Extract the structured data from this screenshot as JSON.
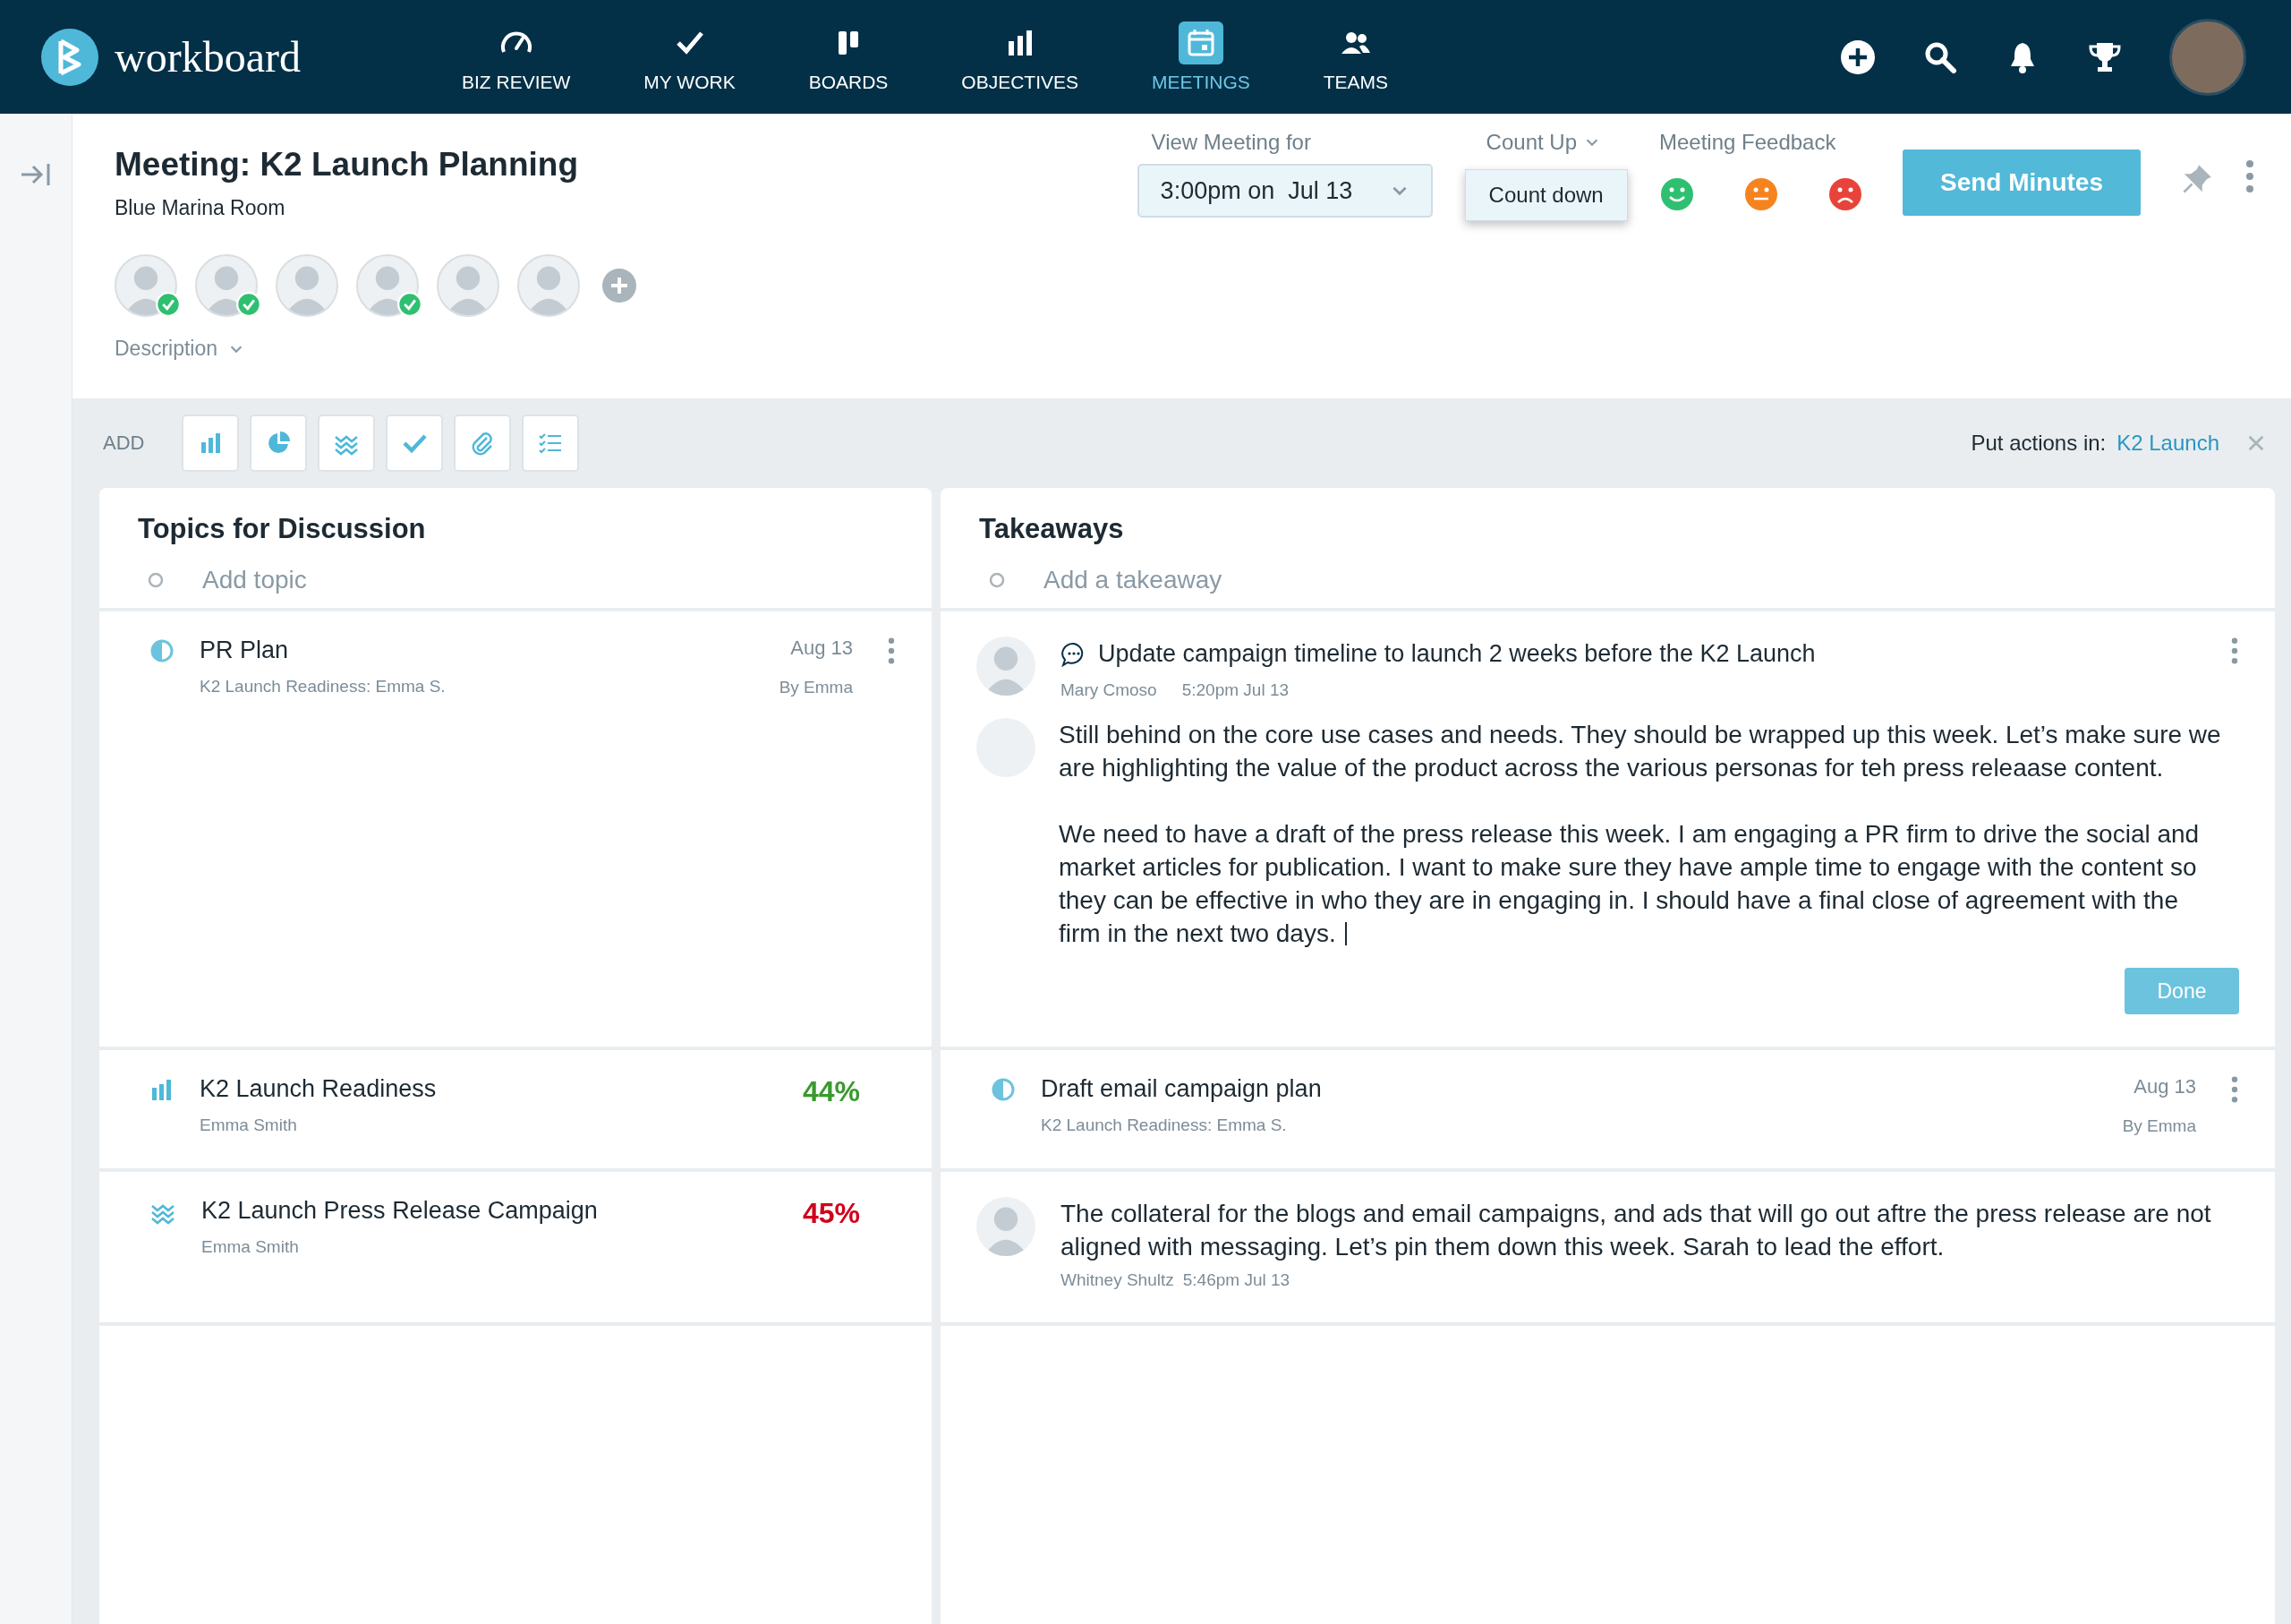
{
  "brand": {
    "name": "workboard"
  },
  "nav": [
    {
      "label": "BIZ REVIEW",
      "selected": false
    },
    {
      "label": "MY WORK",
      "selected": false
    },
    {
      "label": "BOARDS",
      "selected": false
    },
    {
      "label": "OBJECTIVES",
      "selected": false
    },
    {
      "label": "MEETINGS",
      "selected": true
    },
    {
      "label": "TEAMS",
      "selected": false
    }
  ],
  "meeting": {
    "title": "Meeting: K2 Launch Planning",
    "room": "Blue Marina Room",
    "description_label": "Description",
    "attendees": [
      {
        "checked": true
      },
      {
        "checked": true
      },
      {
        "checked": false
      },
      {
        "checked": true
      },
      {
        "checked": false
      },
      {
        "checked": false
      }
    ]
  },
  "view_for": {
    "label": "View Meeting for",
    "value": "3:00pm on  Jul 13"
  },
  "timer": {
    "label": "Count Up",
    "menu": [
      "Count down"
    ]
  },
  "feedback": {
    "label": "Meeting Feedback"
  },
  "send_button": "Send Minutes",
  "toolbar": {
    "label": "ADD",
    "actions_label": "Put actions in:",
    "actions_target": "K2 Launch"
  },
  "topics": {
    "title": "Topics for Discussion",
    "placeholder": "Add topic",
    "items": [
      {
        "kind": "action",
        "title": "PR Plan",
        "subtitle": "K2 Launch Readiness: Emma S.",
        "date": "Aug 13",
        "owner": "By Emma"
      },
      {
        "kind": "objective",
        "title": "K2 Launch Readiness",
        "owner": "Emma Smith",
        "percent": "44%",
        "color": "#3a9a2e"
      },
      {
        "kind": "objective",
        "title": "K2 Launch Press Release Campaign",
        "owner": "Emma Smith",
        "percent": "45%",
        "color": "#d0021b"
      }
    ]
  },
  "takeaways": {
    "title": "Takeaways",
    "placeholder": "Add a takeaway",
    "items": [
      {
        "kind": "takeaway",
        "title": "Update campaign timeline to launch 2 weeks before the K2 Launch",
        "author": "Mary Cmoso",
        "time": "5:20pm Jul 13",
        "reply": {
          "paragraphs": [
            "Still behind on the core use cases and needs. They should be wrapped up this week. Let’s make sure we are highlighting the value of the product across the various personas for teh press releaase content.",
            "We need to have a draft of the press release this week. I am engaging a PR firm to drive the social and market articles for publication. I want to make sure they have ample time to engage with the content so they can be effective in who they are in engaging in. I should have a final close of agreement with the firm in the next two days."
          ],
          "editing": true,
          "button": "Done"
        }
      },
      {
        "kind": "action",
        "title": "Draft email campaign plan",
        "subtitle": "K2 Launch Readiness: Emma S.",
        "date": "Aug 13",
        "owner": "By Emma"
      },
      {
        "kind": "note",
        "text": "The collateral for the blogs and email campaigns, and ads that will go out aftre the press release are not aligned with messaging. Let’s pin them down this week. Sarah to lead the effort.",
        "author": "Whitney Shultz",
        "time": "5:46pm Jul 13"
      }
    ]
  }
}
